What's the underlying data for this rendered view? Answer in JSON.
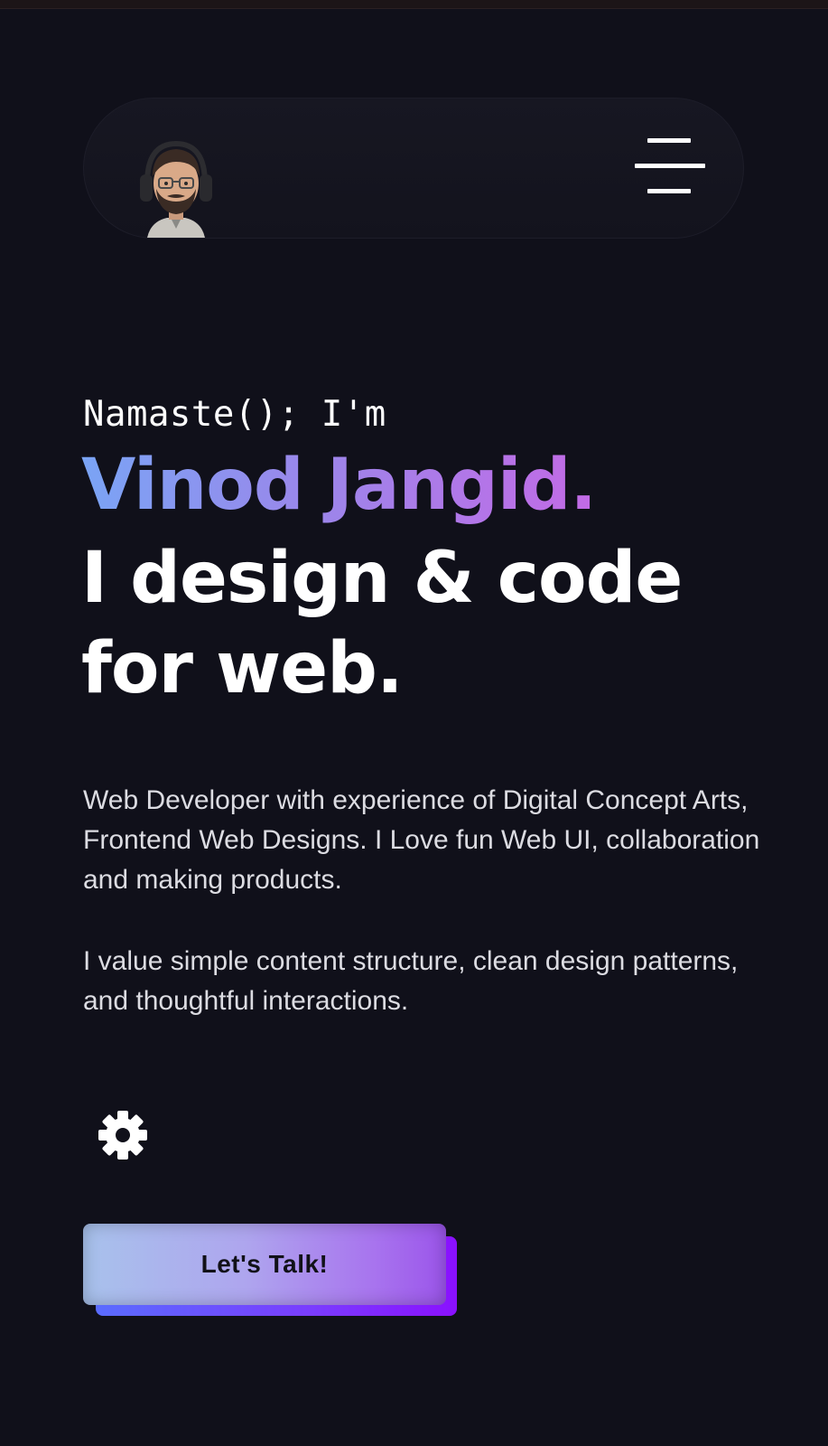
{
  "header": {
    "avatar_icon": "avatar-headphones-icon",
    "menu_icon": "hamburger-menu-icon"
  },
  "hero": {
    "greeting": "Namaste(); I'm",
    "name": "Vinod Jangid.",
    "tagline_line1": "I design & code",
    "tagline_line2": "for web."
  },
  "bio": {
    "paragraph1": "Web Developer with experience of Digital Concept Arts, Frontend Web Designs. I Love fun Web UI, collaboration and making products.",
    "paragraph2": "I value simple content structure, clean design patterns, and thoughtful interactions."
  },
  "settings": {
    "icon": "gear-icon"
  },
  "cta": {
    "label": "Let's Talk!"
  },
  "colors": {
    "background": "#10101a",
    "name_gradient_start": "#7aa4f5",
    "name_gradient_end": "#c36ae6",
    "cta_accent": "#8a10ff"
  }
}
